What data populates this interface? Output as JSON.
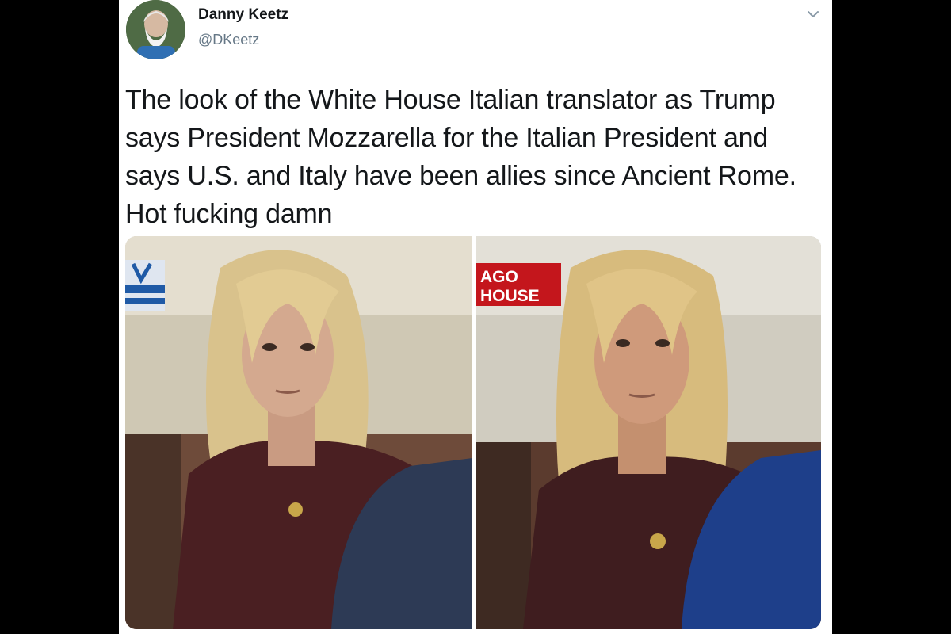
{
  "tweet": {
    "author_name": "Danny Keetz",
    "author_handle": "@DKeetz",
    "text": "The look of the White House Italian translator as Trump\nsays President Mozzarella for the Italian President and\nsays U.S. and Italy have been allies since Ancient Rome.\nHot fucking damn",
    "menu_icon": "chevron-down-icon",
    "avatar_icon": "avatar"
  },
  "media": {
    "right_chyron": "AGO\nHOUSE"
  },
  "colors": {
    "page_background": "#000000",
    "card_background": "#ffffff",
    "text": "#14171a",
    "handle": "#657786",
    "chyron": "#c4161c"
  }
}
